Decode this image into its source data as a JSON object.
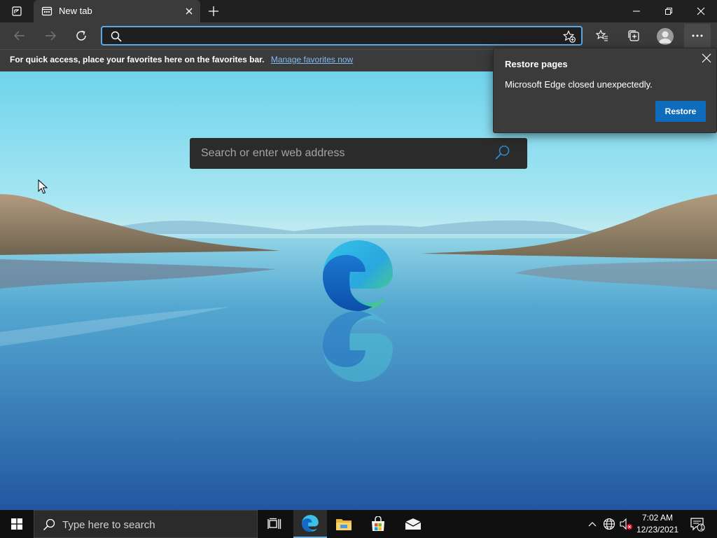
{
  "browser": {
    "tab": {
      "title": "New tab"
    },
    "omnibox": {
      "value": "",
      "placeholder": ""
    },
    "favorites_bar": {
      "message": "For quick access, place your favorites here on the favorites bar.",
      "link": "Manage favorites now"
    }
  },
  "newtab": {
    "search_placeholder": "Search or enter web address"
  },
  "restore_popup": {
    "title": "Restore pages",
    "message": "Microsoft Edge closed unexpectedly.",
    "button": "Restore"
  },
  "taskbar": {
    "search_placeholder": "Type here to search",
    "time": "7:02 AM",
    "date": "12/23/2021",
    "notification_count": "1",
    "pinned": [
      "task-view-icon",
      "edge-icon",
      "file-explorer-icon",
      "store-icon",
      "mail-icon"
    ]
  },
  "colors": {
    "accent": "#0f6cbd",
    "link": "#7dbbf2",
    "omnibox_focus": "#5aa8e6",
    "toolbar": "#3b3b3b",
    "tabstrip": "#202020"
  }
}
